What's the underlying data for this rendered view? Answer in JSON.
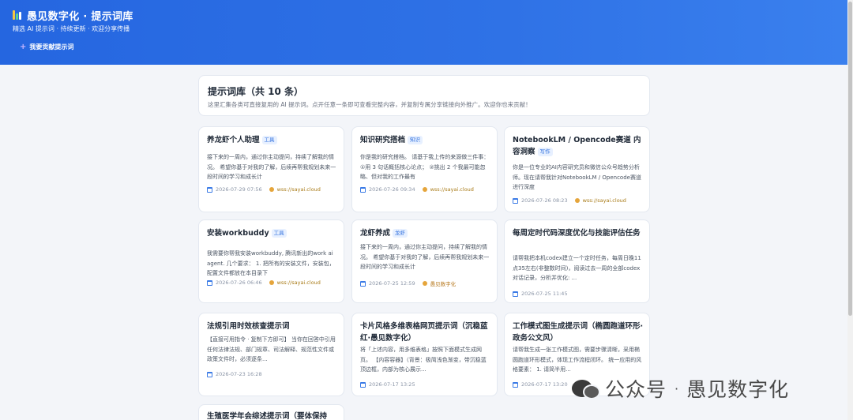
{
  "header": {
    "title": "愚见数字化 · 提示词库",
    "subtitle": "精选 AI 提示词 · 持续更新 · 欢迎分享传播",
    "contribute_label": "我要贡献提示词",
    "contribute_icon": "plus-icon"
  },
  "intro": {
    "heading": "提示词库（共 10 条）",
    "text": "这里汇集各类可直接复用的 AI 提示词。点开任意一条即可查看完整内容，并复制专属分享链接向外推广。欢迎你也来贡献！"
  },
  "cards": [
    {
      "title": "养龙虾个人助理",
      "tag": "工具",
      "desc": "接下来的一周内，通过你主动提问，持续了解我的情况。 希望你基于对我的了解，后续再帮我规划未来一段时间的学习和成长计",
      "date": "2026-07-29 07:56",
      "source": "wss://sayai.cloud"
    },
    {
      "title": "知识研究搭档",
      "tag": "知识",
      "desc": "你是我的研究搭档。 请基于我上传的来源做三件事： ①用 3 句话概括核心论点； ②挑出 2 个我最可能忽略、但对我的工作最有",
      "date": "2026-07-26 09:34",
      "source": "wss://sayai.cloud"
    },
    {
      "title": "NotebookLM / Opencode赛道 内容洞察",
      "tag": "写作",
      "desc": "你是一位专业的AI内容研究员和微信公众号趋势分析师。现在请帮我针对NotebookLM / Opencode赛道 进行深度",
      "date": "2026-07-26 08:23",
      "source": "wss://sayai.cloud"
    },
    {
      "title": "安装workbuddy",
      "tag": "工具",
      "desc": "我需要你帮我安装workbuddy, 腾讯新出的work ai agent. 几个要求： 1. 把所有的安装文件，安装包，配置文件都放在本目录下",
      "date": "2026-07-26 06:46",
      "source": "wss://sayai.cloud"
    },
    {
      "title": "龙虾养成",
      "tag": "龙虾",
      "desc": "接下来的一周内，通过你主动提问，持续了解我的情况。 希望你基于对我的了解，后续再帮我规划未来一段时间的学习和成长计",
      "date": "2026-07-25 12:59",
      "source": "愚见数字化"
    },
    {
      "title": "每周定时代码深度优化与技能评估任务",
      "tag": "",
      "desc": "请帮我把本机codex建立一个定时任务，每周日晚11点35左右(非整数时间)，阅读过去一周的全部codex对话记录，分析并优化: ...",
      "date": "2026-07-25 11:45",
      "source": ""
    },
    {
      "title": "法规引用时效核查提示词",
      "tag": "",
      "desc": "【直接可用指令 · 复制下方即可】 当你在回答中引用任何法律法规、部门规章、司法解释、规范性文件或政策文件时，必须逐条...",
      "date": "2026-07-23 16:28",
      "source": ""
    },
    {
      "title": "卡片风格多维表格网页提示词（沉稳蓝红·愚见数字化）",
      "tag": "",
      "desc": "将「上述内容，用多维表格」按照下面模式生成网页。 【内容容器】（背景：极简浅色渐变，带沉稳蓝顶边框，内部为核心展示...",
      "date": "2026-07-17 13:25",
      "source": ""
    },
    {
      "title": "工作模式图生成提示词（椭圆跑道环形·政务公文风）",
      "tag": "",
      "desc": "请帮我生成一张工作模式图，需要步骤清晰，采用椭圆跑道环形模式，体现工作流程闭环。 统一应用的风格要素： 1. 请简半用...",
      "date": "2026-07-17 13:20",
      "source": ""
    },
    {
      "title": "生殖医学年会综述提示词（要体保持",
      "tag": "",
      "desc": "",
      "date": "",
      "source": ""
    }
  ],
  "watermark": {
    "prefix": "公众号",
    "separator": "·",
    "name": "愚见数字化"
  },
  "colors": {
    "header_start": "#2566e0",
    "header_end": "#3a80ee",
    "badge_text": "#2f6fde",
    "badge_bg": "#e7f0ff"
  }
}
